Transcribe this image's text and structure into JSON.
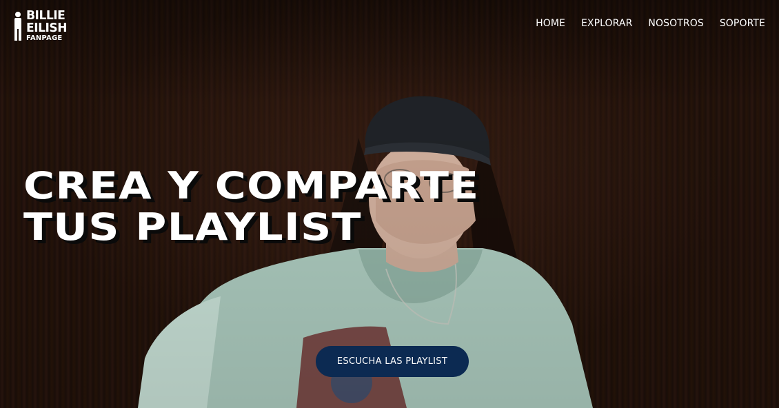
{
  "brand": {
    "line1": "BILLIE",
    "line2": "EILISH",
    "line3": "FANPAGE"
  },
  "nav": {
    "items": [
      {
        "label": "HOME"
      },
      {
        "label": "EXPLORAR"
      },
      {
        "label": "NOSOTROS"
      },
      {
        "label": "SOPORTE"
      }
    ]
  },
  "hero": {
    "headline_line1": "CREA Y COMPARTE",
    "headline_line2": "TUS PLAYLIST",
    "cta_label": "ESCUCHA LAS PLAYLIST",
    "background_image": "photo of a person in a dark beanie and light t-shirt against a dark wooden wall"
  },
  "colors": {
    "cta_background": "#0c2a52",
    "text": "#ffffff",
    "background": "#1f110b"
  }
}
